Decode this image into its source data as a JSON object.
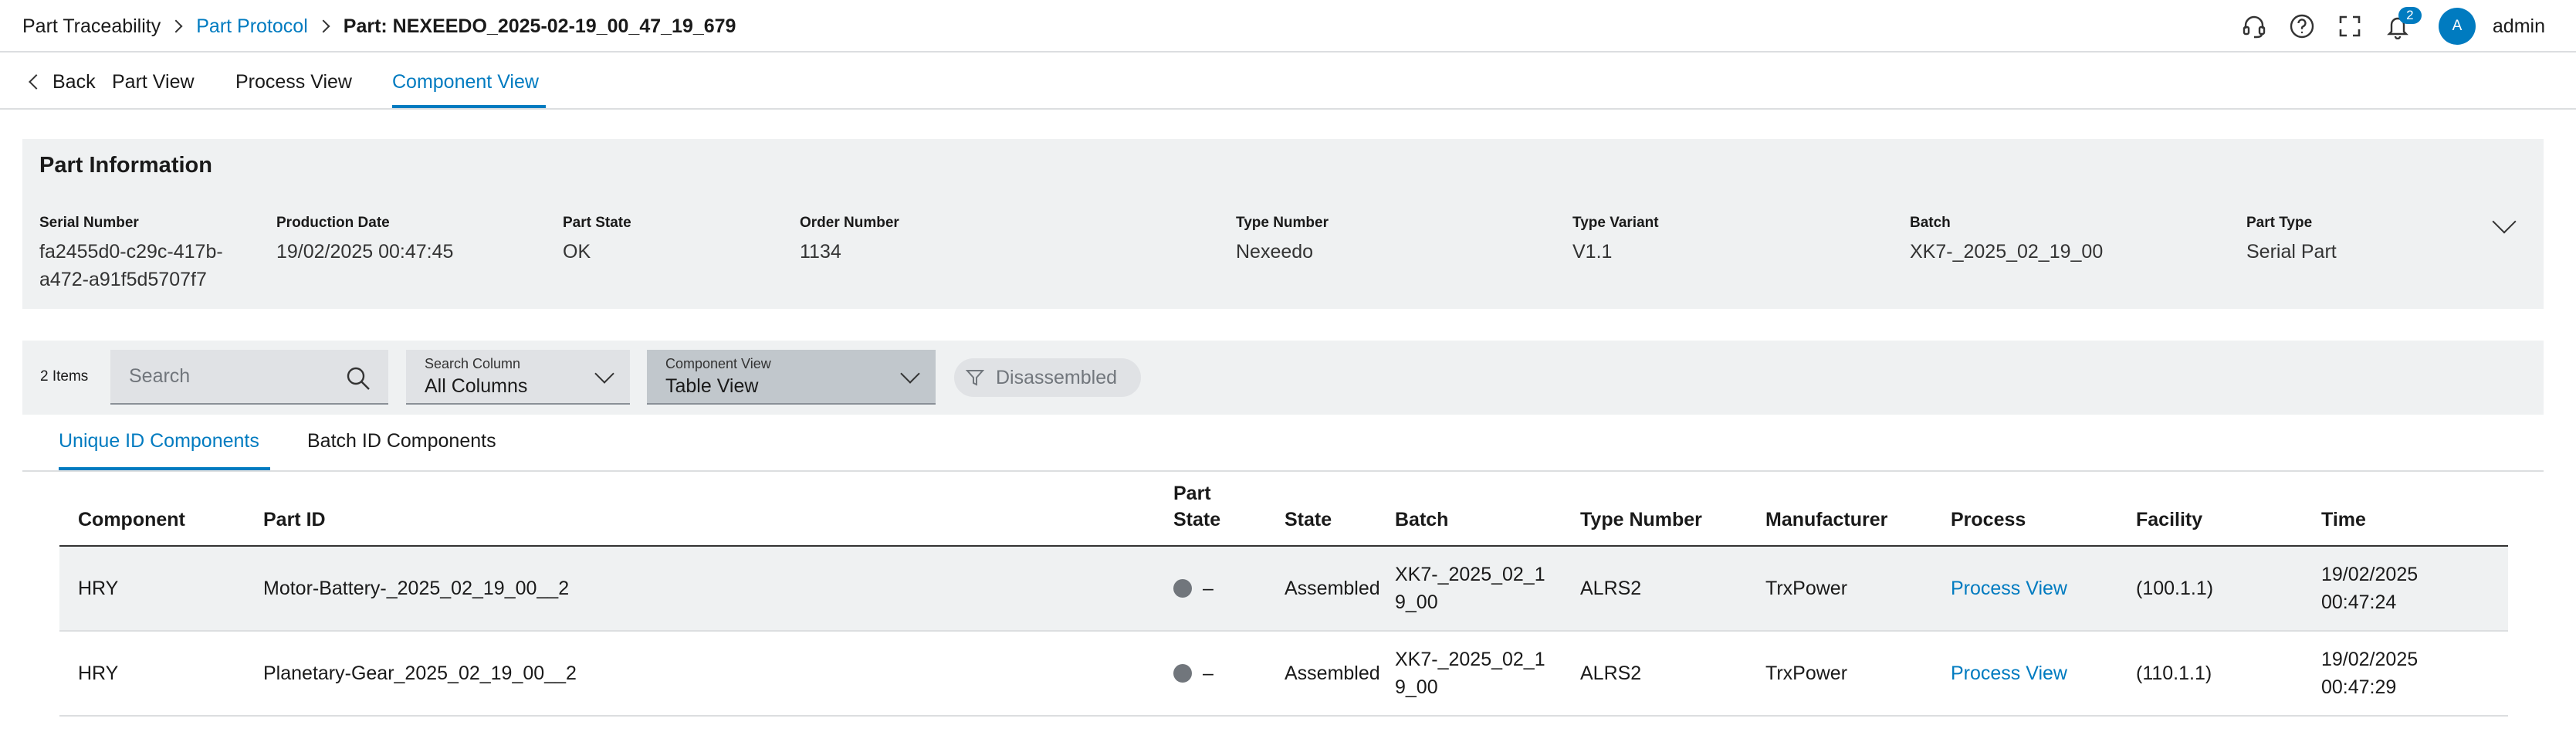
{
  "header": {
    "breadcrumb": [
      {
        "label": "Part Traceability"
      },
      {
        "label": "Part Protocol"
      },
      {
        "label": "Part: NEXEEDO_2025-02-19_00_47_19_679"
      }
    ],
    "notification_count": "2",
    "avatar_initial": "A",
    "user_name": "admin",
    "icons": [
      "headset-icon",
      "help-icon",
      "fullscreen-icon",
      "bell-icon"
    ]
  },
  "subnav": {
    "back_label": "Back",
    "tabs": [
      {
        "label": "Part View"
      },
      {
        "label": "Process View"
      },
      {
        "label": "Component View"
      }
    ],
    "active_tab": "Component View"
  },
  "part_info": {
    "title": "Part Information",
    "fields": [
      {
        "label": "Serial Number",
        "value": "fa2455d0-c29c-417b-a472-a91f5d5707f7"
      },
      {
        "label": "Production Date",
        "value": "19/02/2025 00:47:45"
      },
      {
        "label": "Part State",
        "value": "OK"
      },
      {
        "label": "Order Number",
        "value": "1134"
      },
      {
        "label": "Type Number",
        "value": "Nexeedo"
      },
      {
        "label": "Type Variant",
        "value": "V1.1"
      },
      {
        "label": "Batch",
        "value": "XK7-_2025_02_19_00"
      },
      {
        "label": "Part Type",
        "value": "Serial Part"
      }
    ]
  },
  "toolbar": {
    "items_count": "2 Items",
    "search_placeholder": "Search",
    "search_column_label": "Search Column",
    "search_column_value": "All Columns",
    "component_view_label": "Component View",
    "component_view_value": "Table View",
    "filter_chip": "Disassembled"
  },
  "content_tabs": [
    {
      "label": "Unique ID Components"
    },
    {
      "label": "Batch ID Components"
    }
  ],
  "table": {
    "columns": [
      "Component",
      "Part ID",
      "Part State",
      "State",
      "Batch",
      "Type Number",
      "Manufacturer",
      "Process",
      "Facility",
      "Time"
    ],
    "rows": [
      {
        "component": "HRY",
        "part_id": "Motor-Battery-_2025_02_19_00__2",
        "part_state": "–",
        "state": "Assembled",
        "batch": "XK7-_2025_02_19_00",
        "type_number": "ALRS2",
        "manufacturer": "TrxPower",
        "process": "Process View",
        "facility": "(100.1.1)",
        "time": "19/02/2025 00:47:24"
      },
      {
        "component": "HRY",
        "part_id": "Planetary-Gear_2025_02_19_00__2",
        "part_state": "–",
        "state": "Assembled",
        "batch": "XK7-_2025_02_19_00",
        "type_number": "ALRS2",
        "manufacturer": "TrxPower",
        "process": "Process View",
        "facility": "(110.1.1)",
        "time": "19/02/2025 00:47:29"
      }
    ]
  },
  "colors": {
    "accent": "#007bc0",
    "panel_bg": "#eff1f2",
    "state_dot": "#71767c"
  }
}
